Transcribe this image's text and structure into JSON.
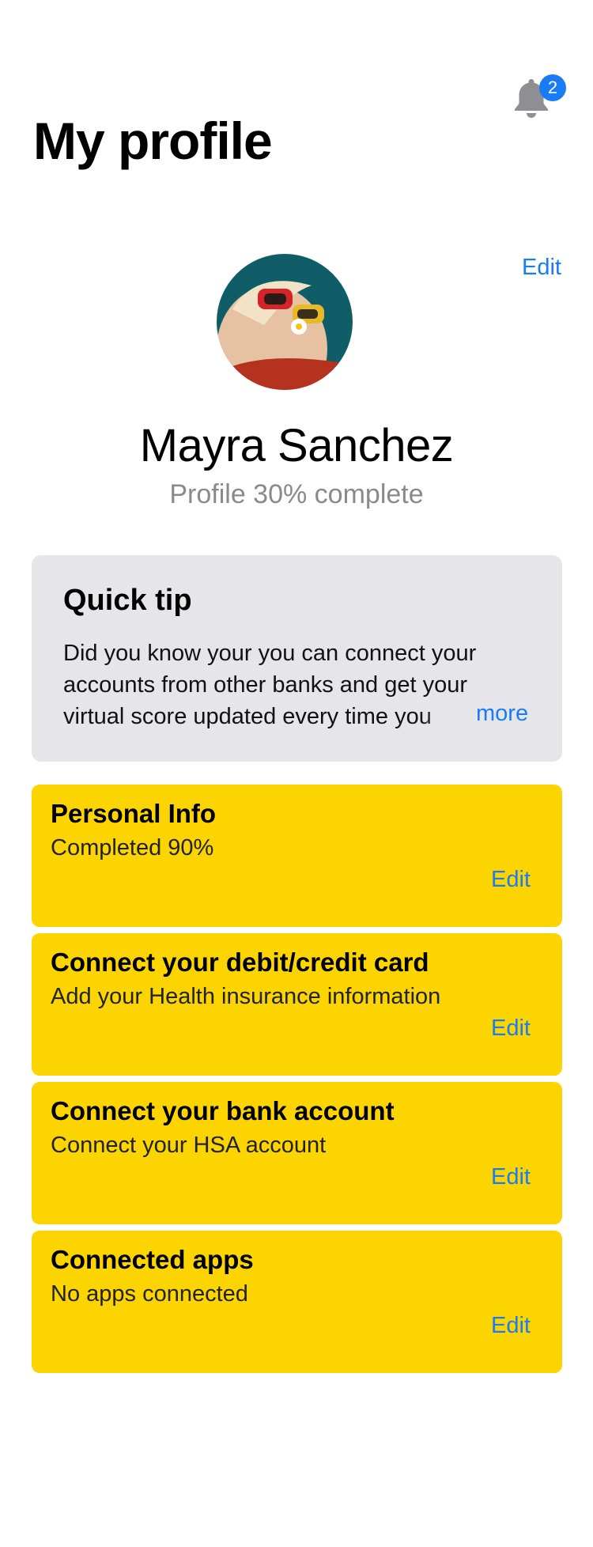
{
  "header": {
    "title": "My profile",
    "notifications": {
      "icon": "bell-icon",
      "count": "2"
    }
  },
  "profile": {
    "edit_label": "Edit",
    "name": "Mayra Sanchez",
    "completion_text": "Profile 30% complete",
    "completion_fraction": 0.3
  },
  "quick_tip": {
    "title": "Quick tip",
    "body": "Did you know your you can connect your accounts from other banks and get your virtual score updated every time you",
    "more_label": "more"
  },
  "sections": [
    {
      "title": "Personal Info",
      "subtitle": "Completed 90%",
      "edit_label": "Edit"
    },
    {
      "title": "Connect your debit/credit card",
      "subtitle": "Add your Health insurance information",
      "edit_label": "Edit"
    },
    {
      "title": "Connect your bank account",
      "subtitle": "Connect your HSA account",
      "edit_label": "Edit"
    },
    {
      "title": "Connected apps",
      "subtitle": "No apps connected",
      "edit_label": "Edit"
    }
  ],
  "colors": {
    "accent": "#1a7cf5",
    "card_yellow": "#fcd500",
    "tip_background": "#e5e5ea",
    "muted_text": "#8a8a8e"
  }
}
